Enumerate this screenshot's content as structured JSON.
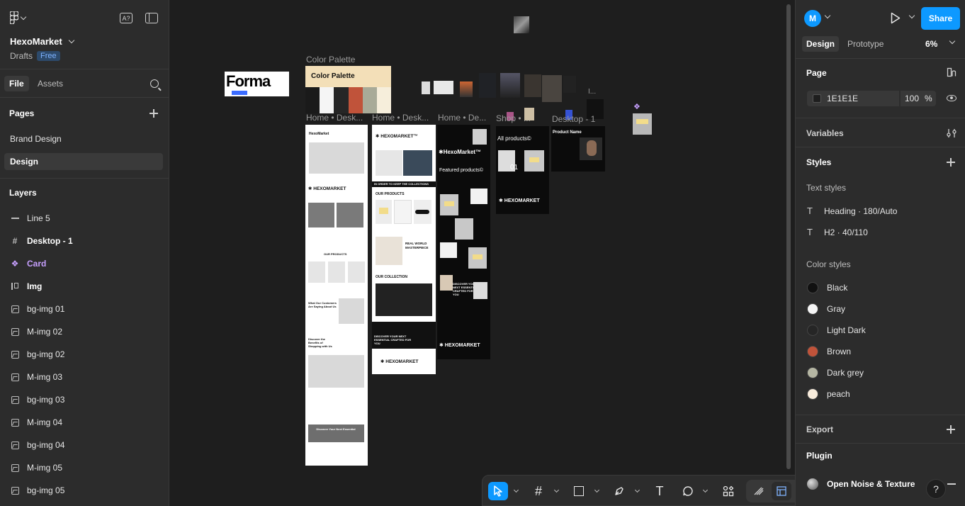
{
  "file": {
    "title": "HexoMarket",
    "location": "Drafts",
    "plan_badge": "Free"
  },
  "left_tabs": {
    "file": "File",
    "assets": "Assets"
  },
  "pages": {
    "heading": "Pages",
    "items": [
      {
        "label": "Brand Design"
      },
      {
        "label": "Design"
      }
    ]
  },
  "layers": {
    "heading": "Layers",
    "items": [
      {
        "label": "Line 5",
        "icon": "line-icon"
      },
      {
        "label": "Desktop - 1",
        "icon": "frame-icon"
      },
      {
        "label": "Card",
        "icon": "component-icon"
      },
      {
        "label": "Img",
        "icon": "auto-layout-icon"
      },
      {
        "label": "bg-img 01",
        "icon": "image-icon"
      },
      {
        "label": "M-img 02",
        "icon": "image-icon"
      },
      {
        "label": "bg-img 02",
        "icon": "image-icon"
      },
      {
        "label": "M-img 03",
        "icon": "image-icon"
      },
      {
        "label": "bg-img 03",
        "icon": "image-icon"
      },
      {
        "label": "M-img 04",
        "icon": "image-icon"
      },
      {
        "label": "bg-img 04",
        "icon": "image-icon"
      },
      {
        "label": "M-img 05",
        "icon": "image-icon"
      },
      {
        "label": "bg-img 05",
        "icon": "image-icon"
      }
    ]
  },
  "canvas": {
    "frame_labels": {
      "color_palette": "Color Palette",
      "home1": "Home • Desk...",
      "home2": "Home • Desk...",
      "home3": "Home • De...",
      "shop": "Shop • ...",
      "desktop1": "Desktop - 1",
      "misc": "I..."
    },
    "forma_text": "Forma",
    "palette_title": "Color Palette",
    "palette_colors": [
      "#1a1a1a",
      "#f5f5f5",
      "#262626",
      "#c0533a",
      "#a8aa98",
      "#f6eedb"
    ],
    "mockup_text": {
      "hexomarket_small": "HexoMarket",
      "hexomarket_logo": "✱ HEXOMARKET",
      "hexomarket_tm": "✱ HEXOMARKET™",
      "hexomarket_featured": "✱HexoMarket™",
      "our_products": "OUR PRODUCTS",
      "our_products_upper": "OUR PRODUCTS",
      "customers": "What Our Customers Are Saying About Us",
      "benefits": "Discover the Benefits of Shopping with Us",
      "next_essential": "Discover Your Next Essential",
      "keep_collections": "IN ORDER TO KEEP THE COLLECTIONS",
      "real_world": "REAL WORLD MASTERPIECE",
      "our_collection": "OUR COLLECTION",
      "discover_dark": "DISCOVER YOUR NEXT ESSENTIAL CRAFTED FOR YOU",
      "featured_products": "Featured products©",
      "all_products": "All products©",
      "num_01": "01",
      "product_name": "Product Name"
    }
  },
  "toolbar": {
    "tools": [
      "move-tool",
      "frame-tool",
      "shape-tool",
      "pen-tool",
      "text-tool",
      "comment-tool",
      "actions-tool"
    ],
    "text_glyph": "T"
  },
  "right": {
    "avatar_initial": "M",
    "share_label": "Share",
    "tabs": {
      "design": "Design",
      "prototype": "Prototype"
    },
    "zoom": "6%",
    "page": {
      "heading": "Page",
      "background_hex": "1E1E1E",
      "opacity": "100",
      "opacity_unit": "%"
    },
    "variables_heading": "Variables",
    "styles_heading": "Styles",
    "text_styles_heading": "Text styles",
    "text_styles": [
      {
        "label": "Heading · 180/Auto"
      },
      {
        "label": "H2 · 40/110"
      }
    ],
    "color_styles_heading": "Color styles",
    "color_styles": [
      {
        "label": "Black",
        "color": "#111111"
      },
      {
        "label": "Gray",
        "color": "#f5f5f5"
      },
      {
        "label": "Light Dark",
        "color": "#262626"
      },
      {
        "label": "Brown",
        "color": "#c0533a"
      },
      {
        "label": "Dark grey",
        "color": "#b5b6a3"
      },
      {
        "label": "peach",
        "color": "#f8ecdc"
      }
    ],
    "export_heading": "Export",
    "plugin_heading": "Plugin",
    "plugin_item": "Open Noise & Texture",
    "help_label": "?"
  },
  "colors": {
    "accent": "#0d99ff",
    "canvas_bg": "#1e1e1e",
    "panel_bg": "#2c2c2c"
  }
}
